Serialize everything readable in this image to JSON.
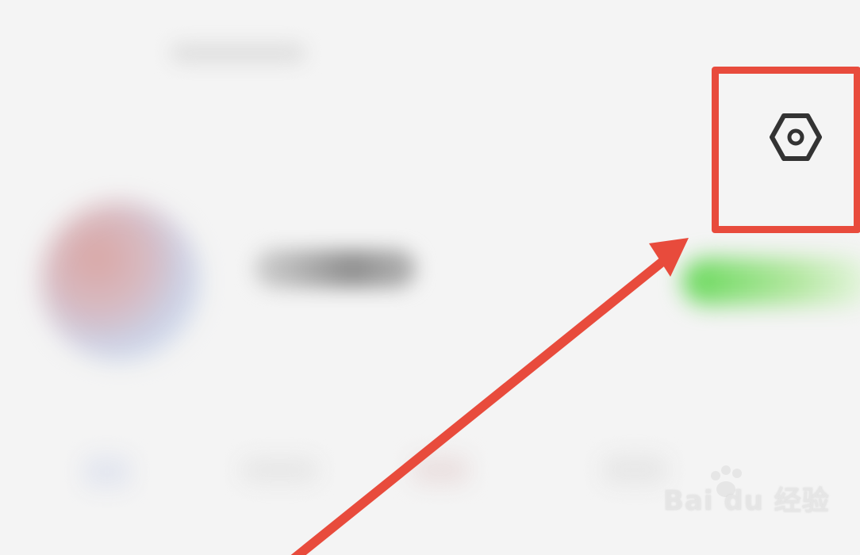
{
  "accent_color": "#e84b3c",
  "icons": {
    "settings": "settings-icon"
  },
  "watermark": {
    "text": "Bai du 经验"
  }
}
